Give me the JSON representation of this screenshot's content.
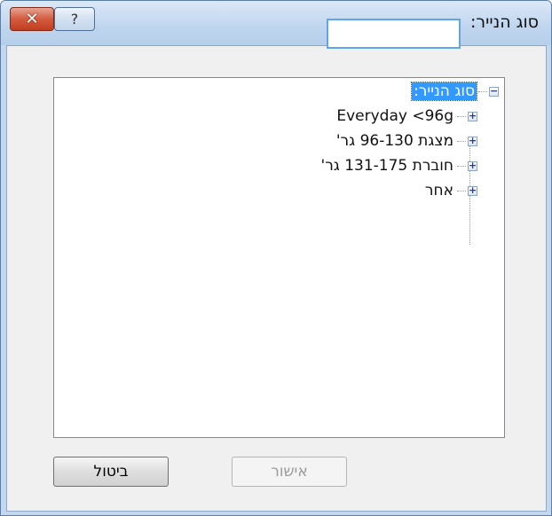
{
  "window": {
    "title": "סוג הנייר:",
    "close_label": "✕",
    "help_label": "?"
  },
  "tree": {
    "root": {
      "label": "סוג הנייר:",
      "expander": "−"
    },
    "items": [
      {
        "label": "Everyday <96g",
        "expander": "+"
      },
      {
        "label": "מצגת 96-130 גר'",
        "expander": "+"
      },
      {
        "label": "חוברת 131-175 גר'",
        "expander": "+"
      },
      {
        "label": "אחר",
        "expander": "+"
      }
    ]
  },
  "buttons": {
    "ok_label": "אישור",
    "cancel_label": "ביטול"
  }
}
